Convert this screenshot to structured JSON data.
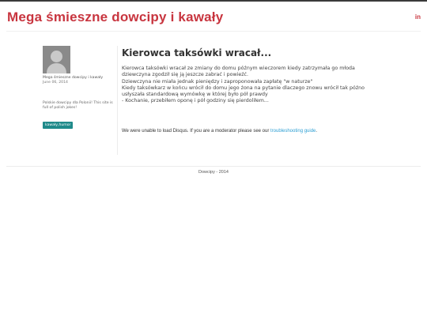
{
  "site": {
    "title": "Mega śmieszne dowcipy i kawały",
    "social_label": "in"
  },
  "author": {
    "name": "Mega śmieszne dowcipy i kawały",
    "date": "June 06, 2014",
    "description": "Polskie dowcipy dla Polonii! This site is full of polish jokes!",
    "tag": "kawały,humor"
  },
  "post": {
    "title": "Kierowca taksówki wracał...",
    "lines": [
      "Kierowca taksówki wracał ze zmiany do domu późnym wieczorem kiedy zatrzymała go młoda",
      "dziewczyna zgodził się ją jeszcze zabrać i powieźć.",
      "Dziewczyna nie miała jednak pieniędzy i zaproponowała zapłatę \"w naturze\"",
      "Kiedy taksówkarz w końcu wrócił do domu jego żona na pytanie dlaczego znowu wrócił tak późno",
      "usłyszała standardową wymówkę w której było pół prawdy",
      "- Kochanie, przebiłem oponę i pół godziny się pierdoliłem..."
    ]
  },
  "disqus": {
    "message": "We were unable to load Disqus. If you are a moderator please see our ",
    "link_text": "troubleshooting guide",
    "end": "."
  },
  "footer": {
    "text": "Dowcipy - 2014"
  },
  "colors": {
    "brand": "#c8353f",
    "tag_bg": "#1f8a8a",
    "link": "#2e9fd3"
  }
}
